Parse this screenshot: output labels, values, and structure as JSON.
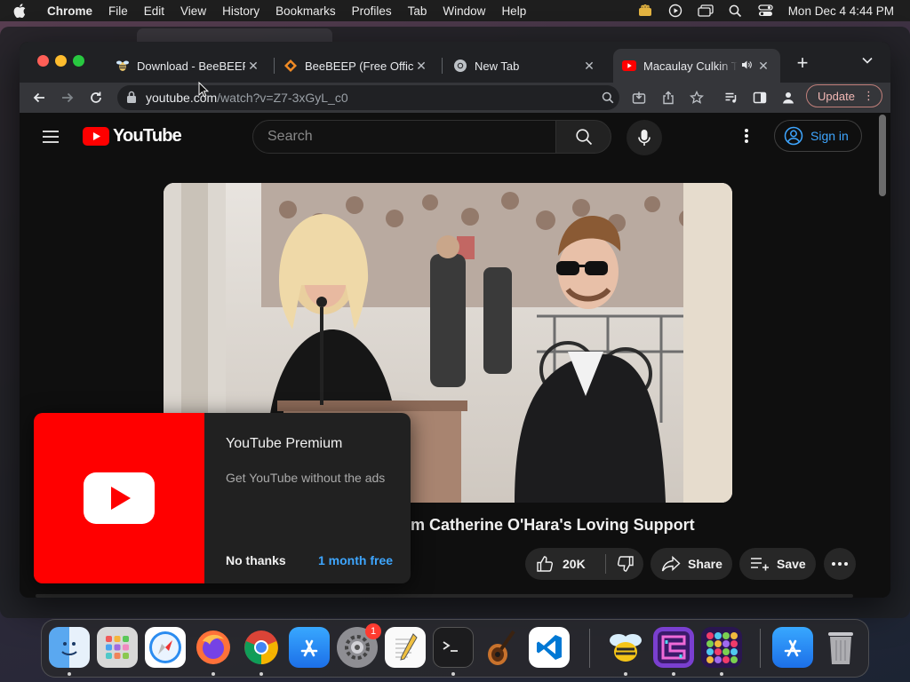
{
  "menubar": {
    "app_name": "Chrome",
    "items": [
      "File",
      "Edit",
      "View",
      "History",
      "Bookmarks",
      "Profiles",
      "Tab",
      "Window",
      "Help"
    ],
    "clock": "Mon Dec 4  4:44 PM",
    "status_icons": [
      "hand-icon",
      "play-circle-icon",
      "window-icon",
      "search-icon",
      "control-center-icon"
    ]
  },
  "browser": {
    "tabs": [
      {
        "title": "Download - BeeBEEP",
        "favicon": "beebeep-bee-icon",
        "active": false
      },
      {
        "title": "BeeBEEP (Free Office",
        "favicon": "beebeep-diamond-icon",
        "active": false
      },
      {
        "title": "New Tab",
        "favicon": "chrome-icon",
        "active": false
      },
      {
        "title": "Macaulay Culkin T",
        "favicon": "youtube-icon",
        "active": true,
        "audio": true
      }
    ],
    "url_host": "youtube.com",
    "url_path": "/watch?v=Z7-3xGyL_c0",
    "update_label": "Update"
  },
  "youtube": {
    "logo_text": "YouTube",
    "search_placeholder": "Search",
    "signin_label": "Sign in",
    "video_title": "m Catherine O'Hara's Loving Support",
    "like_count": "20K",
    "share_label": "Share",
    "save_label": "Save",
    "premium": {
      "title": "YouTube Premium",
      "subtitle": "Get YouTube without the ads",
      "dismiss_label": "No thanks",
      "accept_label": "1 month free"
    },
    "accent": "#ff0000",
    "link_color": "#3ea6ff"
  },
  "dock": {
    "apps": [
      "finder-icon",
      "launchpad-icon",
      "safari-icon",
      "firefox-icon",
      "chrome-icon",
      "app-store-icon",
      "system-settings-icon",
      "textedit-icon",
      "terminal-icon",
      "garageband-icon",
      "vscode-icon",
      "beebeep-icon",
      "maze-game-icon",
      "bubbles-game-icon",
      "app-store-folder-icon",
      "trash-icon"
    ],
    "settings_badge": "1"
  }
}
